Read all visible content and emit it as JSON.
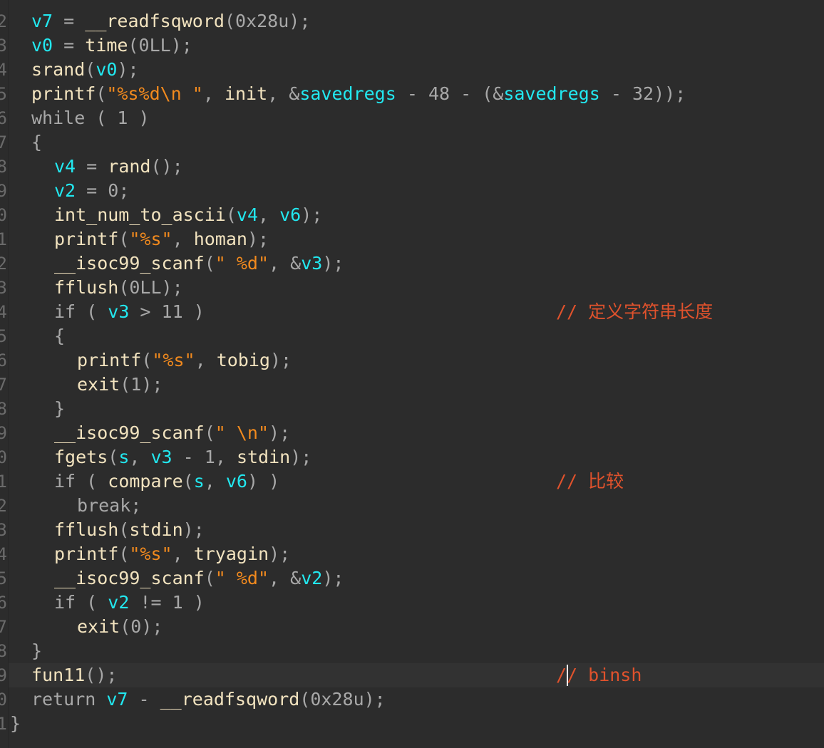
{
  "editor": {
    "first_line_number": 2,
    "current_line_index": 27,
    "caret": {
      "line_index": 27,
      "column": 1,
      "in_comment": true
    },
    "lines": [
      {
        "indent": 1,
        "tokens": [
          [
            "var",
            "v7"
          ],
          [
            "punc",
            " = "
          ],
          [
            "fn",
            "__readfsqword"
          ],
          [
            "punc",
            "("
          ],
          [
            "num",
            "0x28u"
          ],
          [
            "punc",
            ");"
          ]
        ]
      },
      {
        "indent": 1,
        "tokens": [
          [
            "var",
            "v0"
          ],
          [
            "punc",
            " = "
          ],
          [
            "fn",
            "time"
          ],
          [
            "punc",
            "("
          ],
          [
            "num",
            "0LL"
          ],
          [
            "punc",
            ");"
          ]
        ]
      },
      {
        "indent": 1,
        "tokens": [
          [
            "fn",
            "srand"
          ],
          [
            "punc",
            "("
          ],
          [
            "var",
            "v0"
          ],
          [
            "punc",
            ");"
          ]
        ]
      },
      {
        "indent": 1,
        "tokens": [
          [
            "fn",
            "printf"
          ],
          [
            "punc",
            "("
          ],
          [
            "str",
            "\"%s%d\\n \""
          ],
          [
            "punc",
            ", "
          ],
          [
            "id",
            "init"
          ],
          [
            "punc",
            ", &"
          ],
          [
            "var",
            "savedregs"
          ],
          [
            "punc",
            " - "
          ],
          [
            "num",
            "48"
          ],
          [
            "punc",
            " - (&"
          ],
          [
            "var",
            "savedregs"
          ],
          [
            "punc",
            " - "
          ],
          [
            "num",
            "32"
          ],
          [
            "punc",
            "));"
          ]
        ]
      },
      {
        "indent": 1,
        "tokens": [
          [
            "kw",
            "while"
          ],
          [
            "punc",
            " ( "
          ],
          [
            "num",
            "1"
          ],
          [
            "punc",
            " )"
          ]
        ]
      },
      {
        "indent": 1,
        "tokens": [
          [
            "punc",
            "{"
          ]
        ]
      },
      {
        "indent": 2,
        "tokens": [
          [
            "var",
            "v4"
          ],
          [
            "punc",
            " = "
          ],
          [
            "fn",
            "rand"
          ],
          [
            "punc",
            "();"
          ]
        ]
      },
      {
        "indent": 2,
        "tokens": [
          [
            "var",
            "v2"
          ],
          [
            "punc",
            " = "
          ],
          [
            "num",
            "0"
          ],
          [
            "punc",
            ";"
          ]
        ]
      },
      {
        "indent": 2,
        "tokens": [
          [
            "fn",
            "int_num_to_ascii"
          ],
          [
            "punc",
            "("
          ],
          [
            "var",
            "v4"
          ],
          [
            "punc",
            ", "
          ],
          [
            "var",
            "v6"
          ],
          [
            "punc",
            ");"
          ]
        ]
      },
      {
        "indent": 2,
        "tokens": [
          [
            "fn",
            "printf"
          ],
          [
            "punc",
            "("
          ],
          [
            "str",
            "\"%s\""
          ],
          [
            "punc",
            ", "
          ],
          [
            "id",
            "homan"
          ],
          [
            "punc",
            ");"
          ]
        ]
      },
      {
        "indent": 2,
        "tokens": [
          [
            "fn",
            "__isoc99_scanf"
          ],
          [
            "punc",
            "("
          ],
          [
            "str",
            "\" %d\""
          ],
          [
            "punc",
            ", &"
          ],
          [
            "var",
            "v3"
          ],
          [
            "punc",
            ");"
          ]
        ]
      },
      {
        "indent": 2,
        "tokens": [
          [
            "fn",
            "fflush"
          ],
          [
            "punc",
            "("
          ],
          [
            "num",
            "0LL"
          ],
          [
            "punc",
            ");"
          ]
        ]
      },
      {
        "indent": 2,
        "tokens": [
          [
            "kw",
            "if"
          ],
          [
            "punc",
            " ( "
          ],
          [
            "var",
            "v3"
          ],
          [
            "punc",
            " > "
          ],
          [
            "num",
            "11"
          ],
          [
            "punc",
            " )"
          ]
        ],
        "comment": "// 定义字符串长度"
      },
      {
        "indent": 2,
        "tokens": [
          [
            "punc",
            "{"
          ]
        ]
      },
      {
        "indent": 3,
        "tokens": [
          [
            "fn",
            "printf"
          ],
          [
            "punc",
            "("
          ],
          [
            "str",
            "\"%s\""
          ],
          [
            "punc",
            ", "
          ],
          [
            "id",
            "tobig"
          ],
          [
            "punc",
            ");"
          ]
        ]
      },
      {
        "indent": 3,
        "tokens": [
          [
            "fn",
            "exit"
          ],
          [
            "punc",
            "("
          ],
          [
            "num",
            "1"
          ],
          [
            "punc",
            ");"
          ]
        ]
      },
      {
        "indent": 2,
        "tokens": [
          [
            "punc",
            "}"
          ]
        ]
      },
      {
        "indent": 2,
        "tokens": [
          [
            "fn",
            "__isoc99_scanf"
          ],
          [
            "punc",
            "("
          ],
          [
            "str",
            "\" \\n\""
          ],
          [
            "punc",
            ");"
          ]
        ]
      },
      {
        "indent": 2,
        "tokens": [
          [
            "fn",
            "fgets"
          ],
          [
            "punc",
            "("
          ],
          [
            "var",
            "s"
          ],
          [
            "punc",
            ", "
          ],
          [
            "var",
            "v3"
          ],
          [
            "punc",
            " - "
          ],
          [
            "num",
            "1"
          ],
          [
            "punc",
            ", "
          ],
          [
            "id",
            "stdin"
          ],
          [
            "punc",
            ");"
          ]
        ]
      },
      {
        "indent": 2,
        "tokens": [
          [
            "kw",
            "if"
          ],
          [
            "punc",
            " ( "
          ],
          [
            "fn",
            "compare"
          ],
          [
            "punc",
            "("
          ],
          [
            "var",
            "s"
          ],
          [
            "punc",
            ", "
          ],
          [
            "var",
            "v6"
          ],
          [
            "punc",
            ") )"
          ]
        ],
        "comment": "// 比较"
      },
      {
        "indent": 3,
        "tokens": [
          [
            "kw",
            "break"
          ],
          [
            "punc",
            ";"
          ]
        ]
      },
      {
        "indent": 2,
        "tokens": [
          [
            "fn",
            "fflush"
          ],
          [
            "punc",
            "("
          ],
          [
            "id",
            "stdin"
          ],
          [
            "punc",
            ");"
          ]
        ]
      },
      {
        "indent": 2,
        "tokens": [
          [
            "fn",
            "printf"
          ],
          [
            "punc",
            "("
          ],
          [
            "str",
            "\"%s\""
          ],
          [
            "punc",
            ", "
          ],
          [
            "id",
            "tryagin"
          ],
          [
            "punc",
            ");"
          ]
        ]
      },
      {
        "indent": 2,
        "tokens": [
          [
            "fn",
            "__isoc99_scanf"
          ],
          [
            "punc",
            "("
          ],
          [
            "str",
            "\" %d\""
          ],
          [
            "punc",
            ", &"
          ],
          [
            "var",
            "v2"
          ],
          [
            "punc",
            ");"
          ]
        ]
      },
      {
        "indent": 2,
        "tokens": [
          [
            "kw",
            "if"
          ],
          [
            "punc",
            " ( "
          ],
          [
            "var",
            "v2"
          ],
          [
            "punc",
            " != "
          ],
          [
            "num",
            "1"
          ],
          [
            "punc",
            " )"
          ]
        ]
      },
      {
        "indent": 3,
        "tokens": [
          [
            "fn",
            "exit"
          ],
          [
            "punc",
            "("
          ],
          [
            "num",
            "0"
          ],
          [
            "punc",
            ");"
          ]
        ]
      },
      {
        "indent": 1,
        "tokens": [
          [
            "punc",
            "}"
          ]
        ]
      },
      {
        "indent": 1,
        "tokens": [
          [
            "fn",
            "fun11"
          ],
          [
            "punc",
            "();"
          ]
        ],
        "comment": "// binsh"
      },
      {
        "indent": 1,
        "tokens": [
          [
            "kw",
            "return "
          ],
          [
            "var",
            "v7"
          ],
          [
            "punc",
            " - "
          ],
          [
            "fn",
            "__readfsqword"
          ],
          [
            "punc",
            "("
          ],
          [
            "num",
            "0x28u"
          ],
          [
            "punc",
            ");"
          ]
        ]
      },
      {
        "indent": 0,
        "tokens": [
          [
            "punc",
            "}"
          ]
        ]
      }
    ]
  }
}
